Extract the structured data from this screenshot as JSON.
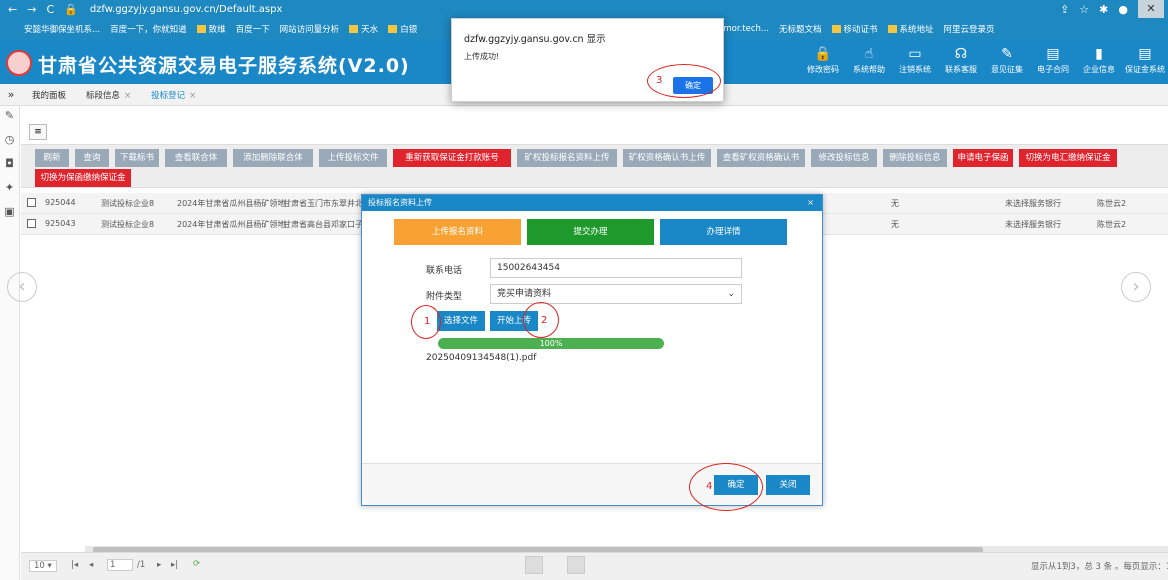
{
  "browser": {
    "url": "dzfw.ggzyjy.gansu.gov.cn/Default.aspx",
    "bookmarks": [
      "安懿华御保坐机系...",
      "百度一下，你就知道",
      "致维",
      "百度一下",
      "网站访问量分析",
      "天水",
      "白银",
      "https://timor.tech...",
      "无标题文档",
      "移动证书",
      "系统地址",
      "阿里云登录页"
    ]
  },
  "app": {
    "title": "甘肃省公共资源交易电子服务系统(V2.0)",
    "topnav": [
      "修改密码",
      "系统帮助",
      "注销系统",
      "联系客服",
      "意见征集",
      "电子合同",
      "企业信息",
      "保证金系统"
    ]
  },
  "tabs": [
    {
      "label": "我的面板"
    },
    {
      "label": "标段信息",
      "x": "×"
    },
    {
      "label": "投标登记",
      "x": "×"
    }
  ],
  "toolbar": {
    "buttons": [
      "刷新",
      "查询",
      "下载标书",
      "查看联合体",
      "添加删除联合体",
      "上传投标文件",
      "重新获取保证金打款账号",
      "矿权投标报名资料上传",
      "矿权资格确认书上传",
      "查看矿权资格确认书",
      "修改投标信息",
      "删除投标信息",
      "申请电子保函",
      "切换为电汇缴纳保证金",
      "切换为保函缴纳保证金"
    ]
  },
  "table": {
    "rows": [
      {
        "id": "925044",
        "company": "测试投标企业8",
        "project": "2024年甘肃省瓜州县杨矿领地",
        "place": "甘肃省玉门市东翠井北",
        "bank_flag": "无",
        "bank": "未选择服务银行",
        "person": "陈世云2"
      },
      {
        "id": "925043",
        "company": "测试投标企业8",
        "project": "2024年甘肃省瓜州县杨矿领地",
        "place": "甘肃省高台县邓家口子",
        "bank_flag": "无",
        "bank": "未选择服务银行",
        "person": "陈世云2"
      }
    ]
  },
  "pager": {
    "page_size": "10",
    "page": "1",
    "total_pages": "/1",
    "summary": "显示从1到3，总 3 条 。每页显示：10"
  },
  "modal": {
    "title": "投标报名资料上传",
    "close": "×",
    "steps": [
      "上传报名资料",
      "提交办理",
      "办理详情"
    ],
    "phone_label": "联系电话",
    "phone_value": "15002643454",
    "type_label": "附件类型",
    "type_value": "竞买申请资料",
    "choose_file": "选择文件",
    "start_upload": "开始上传",
    "progress_text": "100%",
    "progress_value": 1.0,
    "file_name": "20250409134548(1).pdf",
    "confirm": "确定",
    "close_btn": "关闭"
  },
  "alert": {
    "title": "dzfw.ggzyjy.gansu.gov.cn 显示",
    "message": "上传成功!",
    "ok": "确定"
  },
  "annotations": [
    "1",
    "2",
    "3",
    "4"
  ],
  "colors": {
    "brand": "#1a87c7",
    "danger": "#e0242e",
    "step1": "#f7a233",
    "step2": "#1e9a2c",
    "step3": "#1a87c7",
    "progress": "#4caf50",
    "annotation": "#dd2222"
  }
}
